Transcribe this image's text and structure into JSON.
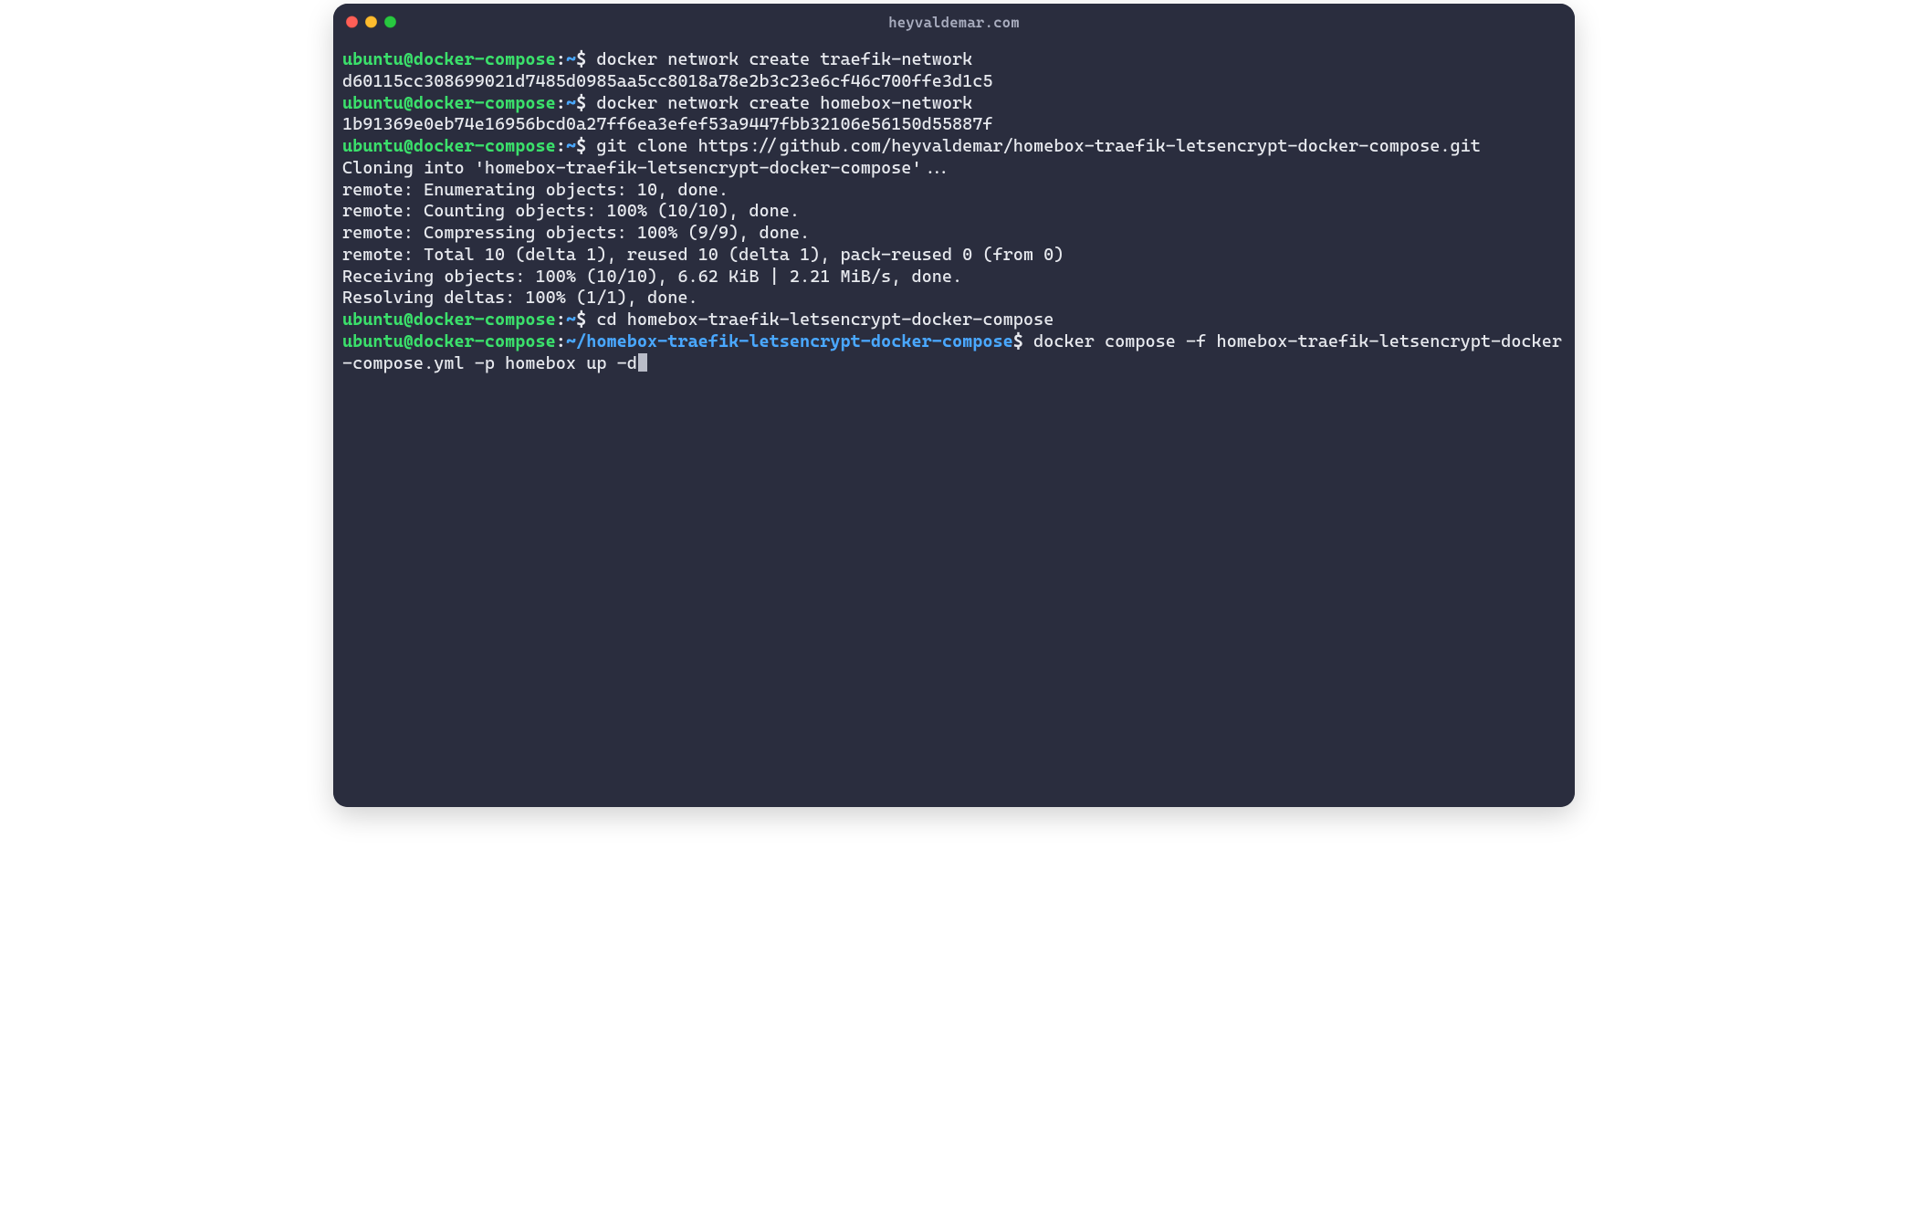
{
  "window": {
    "title": "heyvaldemar.com"
  },
  "colors": {
    "bg": "#2a2d3e",
    "text": "#e7e9ee",
    "prompt_user": "#3be06b",
    "prompt_path": "#4aa8ff",
    "titlebar_text": "#a9adbf",
    "traffic_close": "#ff5f57",
    "traffic_min": "#febc2e",
    "traffic_zoom": "#28c840",
    "cursor": "#b9bcc8"
  },
  "prompt": {
    "user": "ubuntu@docker-compose",
    "sep": ":",
    "home_path": "~",
    "project_path": "~/homebox-traefik-letsencrypt-docker-compose",
    "end": "$ "
  },
  "lines": {
    "cmd1": "docker network create traefik-network",
    "out1": "d60115cc308699021d7485d0985aa5cc8018a78e2b3c23e6cf46c700ffe3d1c5",
    "cmd2": "docker network create homebox-network",
    "out2": "1b91369e0eb74e16956bcd0a27ff6ea3efef53a9447fbb32106e56150d55887f",
    "cmd3": "git clone https://github.com/heyvaldemar/homebox-traefik-letsencrypt-docker-compose.git",
    "out3a": "Cloning into 'homebox-traefik-letsencrypt-docker-compose'...",
    "out3b": "remote: Enumerating objects: 10, done.",
    "out3c": "remote: Counting objects: 100% (10/10), done.",
    "out3d": "remote: Compressing objects: 100% (9/9), done.",
    "out3e": "remote: Total 10 (delta 1), reused 10 (delta 1), pack-reused 0 (from 0)",
    "out3f": "Receiving objects: 100% (10/10), 6.62 KiB | 2.21 MiB/s, done.",
    "out3g": "Resolving deltas: 100% (1/1), done.",
    "cmd4": "cd homebox-traefik-letsencrypt-docker-compose",
    "cmd5": "docker compose -f homebox-traefik-letsencrypt-docker-compose.yml -p homebox up -d"
  }
}
